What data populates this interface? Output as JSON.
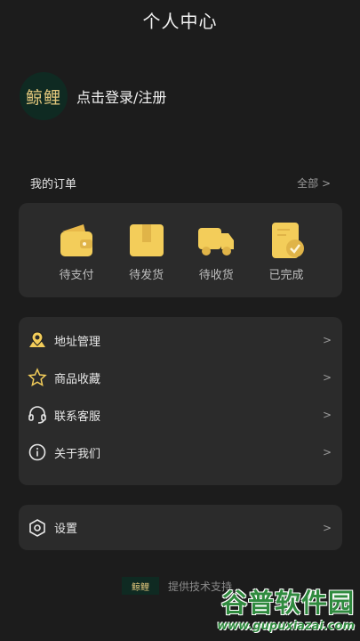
{
  "header": {
    "title": "个人中心"
  },
  "profile": {
    "avatar_text": "鲸鲤",
    "login_label": "点击登录/注册"
  },
  "orders": {
    "title": "我的订单",
    "all_label": "全部 >",
    "items": [
      {
        "label": "待支付",
        "icon": "wallet-icon"
      },
      {
        "label": "待发货",
        "icon": "package-icon"
      },
      {
        "label": "待收货",
        "icon": "truck-icon"
      },
      {
        "label": "已完成",
        "icon": "completed-clipboard-icon"
      }
    ]
  },
  "menu": {
    "items": [
      {
        "label": "地址管理",
        "icon": "location-pin-icon",
        "chevron": ">"
      },
      {
        "label": "商品收藏",
        "icon": "star-icon",
        "chevron": ">"
      },
      {
        "label": "联系客服",
        "icon": "headset-icon",
        "chevron": ">"
      },
      {
        "label": "关于我们",
        "icon": "info-icon",
        "chevron": ">"
      }
    ]
  },
  "settings": {
    "label": "设置",
    "icon": "hexagon-gear-icon",
    "chevron": ">"
  },
  "footer": {
    "logo_text": "鲸鲤",
    "text": "提供技术支持"
  },
  "watermark": {
    "main": "谷普软件园",
    "url": "www.gupuxiazai.com"
  },
  "colors": {
    "background": "#1c1c1c",
    "card": "#2b2b2b",
    "accent": "#f3cd5a"
  }
}
